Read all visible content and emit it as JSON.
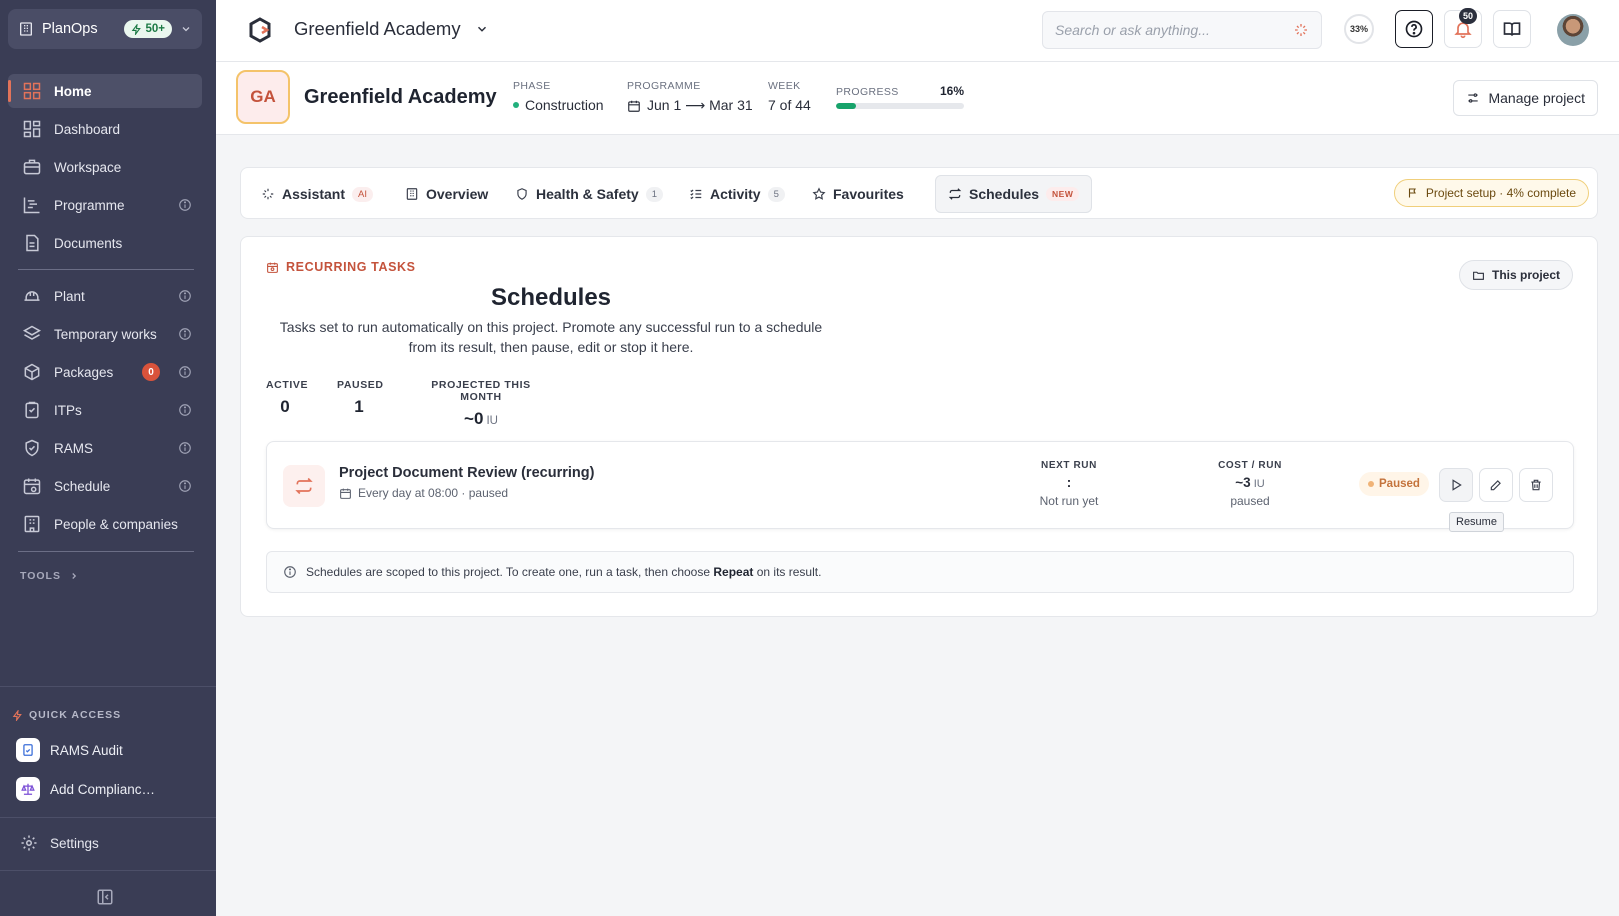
{
  "sidebar": {
    "brand": {
      "label": "PlanOps",
      "badge": "50+"
    },
    "items": [
      {
        "label": "Home",
        "icon": "grid-icon",
        "active": true,
        "info": false
      },
      {
        "label": "Dashboard",
        "icon": "dashboard-icon",
        "info": false
      },
      {
        "label": "Workspace",
        "icon": "briefcase-icon",
        "info": false
      },
      {
        "label": "Programme",
        "icon": "gantt-icon",
        "info": true
      },
      {
        "label": "Documents",
        "icon": "document-icon",
        "info": false
      },
      {
        "label": "Plant",
        "icon": "hardhat-icon",
        "info": true
      },
      {
        "label": "Temporary works",
        "icon": "layers-icon",
        "info": true
      },
      {
        "label": "Packages",
        "icon": "package-icon",
        "info": true,
        "count": "0"
      },
      {
        "label": "ITPs",
        "icon": "clipboard-icon",
        "info": true
      },
      {
        "label": "RAMS",
        "icon": "shield-icon",
        "info": true
      },
      {
        "label": "Schedule",
        "icon": "calendar-clock-icon",
        "info": true
      },
      {
        "label": "People & companies",
        "icon": "building-icon",
        "info": false
      }
    ],
    "tools_label": "TOOLS",
    "quick_access": {
      "title": "QUICK ACCESS",
      "items": [
        {
          "label": "RAMS Audit",
          "icon": "audit-icon"
        },
        {
          "label": "Add Complianc…",
          "icon": "scales-icon"
        }
      ]
    },
    "settings_label": "Settings"
  },
  "topbar": {
    "project_title": "Greenfield Academy",
    "search_placeholder": "Search or ask anything...",
    "usage_percent": "33%",
    "notifications_count": "50"
  },
  "project": {
    "initials": "GA",
    "name": "Greenfield Academy",
    "phase": {
      "key": "PHASE",
      "value": "Construction"
    },
    "programme": {
      "key": "PROGRAMME",
      "value": "Jun 1 ⟶ Mar 31"
    },
    "week": {
      "key": "WEEK",
      "value": "7 of 44"
    },
    "progress": {
      "key": "PROGRESS",
      "value": "16%",
      "fraction": 0.16
    },
    "manage_label": "Manage project"
  },
  "tabs": [
    {
      "label": "Assistant",
      "badge": "AI",
      "icon": "sparkle-icon"
    },
    {
      "label": "Overview",
      "icon": "building-icon"
    },
    {
      "label": "Health & Safety",
      "badge": "1",
      "icon": "shield-icon"
    },
    {
      "label": "Activity",
      "badge": "5",
      "icon": "list-check-icon"
    },
    {
      "label": "Favourites",
      "icon": "star-icon"
    },
    {
      "label": "Schedules",
      "badge": "NEW",
      "icon": "repeat-icon",
      "active": true
    }
  ],
  "setup_pill": "Project setup · 4% complete",
  "schedules": {
    "eyebrow": "RECURRING TASKS",
    "scope_button": "This project",
    "title": "Schedules",
    "description": "Tasks set to run automatically on this project. Promote any successful run to a schedule from its result, then pause, edit or stop it here.",
    "stats": [
      {
        "key": "ACTIVE",
        "value": "0",
        "unit": ""
      },
      {
        "key": "PAUSED",
        "value": "1",
        "unit": ""
      },
      {
        "key": "PROJECTED THIS MONTH",
        "value": "~0",
        "unit": "IU"
      }
    ],
    "row": {
      "title": "Project Document Review (recurring)",
      "subtitle": "Every day at 08:00 · paused",
      "next_run": {
        "key": "NEXT RUN",
        "value": ":",
        "sub": "Not run yet"
      },
      "cost": {
        "key": "COST / RUN",
        "value": "~3",
        "unit": "IU",
        "sub": "paused"
      },
      "status": "Paused",
      "tooltip": "Resume"
    },
    "note": {
      "before": "Schedules are scoped to this project. To create one, run a task, then choose ",
      "strong": "Repeat",
      "after": " on its result."
    }
  },
  "colors": {
    "accent": "#e2735a",
    "sidebar": "#3a3d55",
    "progress": "#17a36b",
    "badge_red": "#d9533b"
  }
}
